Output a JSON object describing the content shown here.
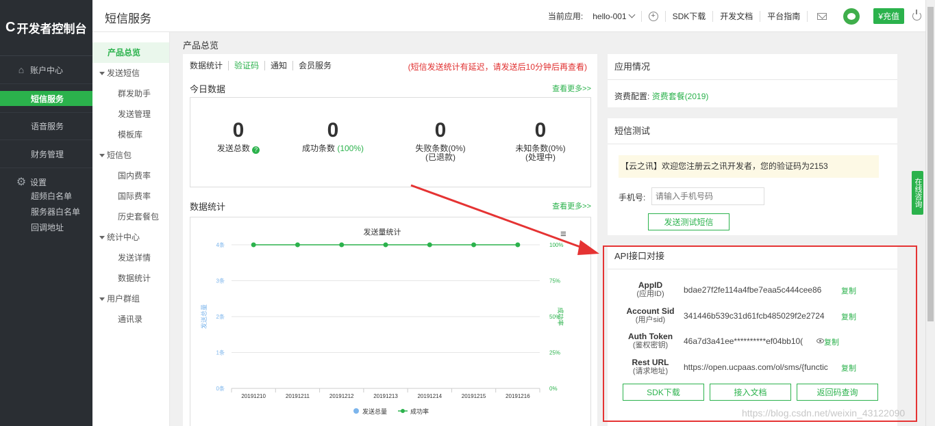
{
  "app": {
    "logo_mark": "C",
    "logo_text": "开发者控制台"
  },
  "sidebar": {
    "items": [
      {
        "label": "账户中心",
        "icon": "home-icon"
      },
      {
        "label": "短信服务",
        "active": true
      },
      {
        "label": "语音服务"
      },
      {
        "label": "财务管理"
      }
    ],
    "settings": {
      "label": "设置",
      "icon": "gear-icon",
      "sub": [
        "超频白名单",
        "服务器白名单",
        "回调地址"
      ]
    }
  },
  "topbar": {
    "title": "短信服务",
    "current_app_label": "当前应用:",
    "current_app_value": "hello-001",
    "links": [
      "SDK下载",
      "开发文档",
      "平台指南"
    ],
    "recharge": "¥充值"
  },
  "subnav": {
    "active": "产品总览",
    "groups": [
      {
        "label": "发送短信",
        "items": [
          "群发助手",
          "发送管理",
          "模板库"
        ]
      },
      {
        "label": "短信包",
        "items": [
          "国内费率",
          "国际费率",
          "历史套餐包"
        ]
      },
      {
        "label": "统计中心",
        "items": [
          "发送详情",
          "数据统计"
        ]
      },
      {
        "label": "用户群组",
        "items": [
          "通讯录"
        ]
      }
    ]
  },
  "main": {
    "breadcrumb": "产品总览",
    "tabs": [
      "数据统计",
      "验证码",
      "通知",
      "会员服务"
    ],
    "active_tab": "验证码",
    "notice": "(短信发送统计有延迟，请发送后10分钟后再查看)",
    "today": {
      "title": "今日数据",
      "more": "查看更多>>",
      "stats": [
        {
          "num": "0",
          "label": "发送总数",
          "extra": ""
        },
        {
          "num": "0",
          "label": "成功条数",
          "extra": "(100%)"
        },
        {
          "num": "0",
          "label": "失败条数(0%)",
          "extra": "(已退款)"
        },
        {
          "num": "0",
          "label": "未知条数(0%)",
          "extra": "(处理中)"
        }
      ]
    },
    "stats_title": "数据统计",
    "stats_more": "查看更多>>"
  },
  "chart_data": {
    "type": "line",
    "title": "发送量统计",
    "categories": [
      "20191210",
      "20191211",
      "20191212",
      "20191213",
      "20191214",
      "20191215",
      "20191216"
    ],
    "y_left_ticks": [
      "0条",
      "1条",
      "2条",
      "3条",
      "4条"
    ],
    "y_right_ticks": [
      "0%",
      "25%",
      "50%",
      "75%",
      "100%"
    ],
    "ylabel_left": "发送总量",
    "ylabel_right": "成功率",
    "ylim_left": [
      0,
      4
    ],
    "ylim_right": [
      0,
      100
    ],
    "series": [
      {
        "name": "发送总量",
        "values": [
          0,
          0,
          0,
          0,
          0,
          0,
          0
        ],
        "color": "#7cb5ec"
      },
      {
        "name": "成功率",
        "values": [
          100,
          100,
          100,
          100,
          100,
          100,
          100
        ],
        "color": "#2bb24c"
      }
    ],
    "legend": "bottom-center"
  },
  "right": {
    "app_info": {
      "title": "应用情况",
      "config_label": "资费配置:",
      "config_value": "资费套餐(2019)"
    },
    "sms_test": {
      "title": "短信测试",
      "message": "【云之讯】欢迎您注册云之讯开发者，您的验证码为2153",
      "phone_label": "手机号:",
      "phone_placeholder": "请输入手机号码",
      "send_button": "发送测试短信"
    },
    "api": {
      "title": "API接口对接",
      "rows": [
        {
          "key": "AppID",
          "sub": "(应用ID)",
          "value": "bdae27f2fe114a4fbe7eaa5c444cee86",
          "copy": "复制"
        },
        {
          "key": "Account Sid",
          "sub": "(用户sid)",
          "value": "341446b539c31d61fcb485029f2e2724",
          "copy": "复制"
        },
        {
          "key": "Auth Token",
          "sub": "(鉴权密钥)",
          "value": "46a7d3a41ee**********ef04bb10(",
          "copy": "复制"
        },
        {
          "key": "Rest URL",
          "sub": "(请求地址)",
          "value": "https://open.ucpaas.com/ol/sms/{functic",
          "copy": "复制"
        }
      ],
      "buttons": [
        "SDK下载",
        "接入文档",
        "返回码查询"
      ]
    }
  },
  "float_tab": "在线咨询",
  "watermark": "https://blog.csdn.net/weixin_43122090",
  "colors": {
    "accent": "#2bb24c",
    "sidebar": "#2a2e33",
    "annotation": "#e53333"
  }
}
